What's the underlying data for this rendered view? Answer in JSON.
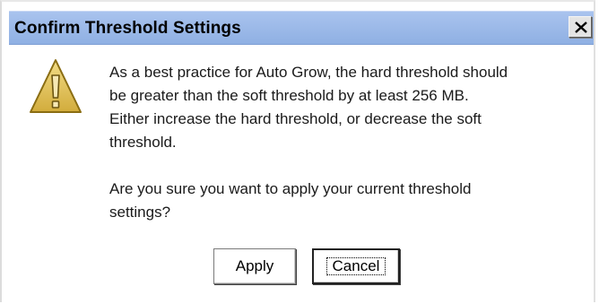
{
  "dialog": {
    "title": "Confirm Threshold Settings",
    "close_label": "X",
    "icon": "warning-icon",
    "message_lines": [
      "As a best practice for Auto Grow, the hard threshold should",
      "be greater than the soft threshold by at least 256 MB.",
      "Either increase the hard threshold, or decrease the soft",
      "threshold."
    ],
    "question_lines": [
      "Are you sure you want to apply your current threshold",
      "settings?"
    ],
    "buttons": {
      "apply": "Apply",
      "cancel": "Cancel"
    }
  },
  "colors": {
    "titlebar": "#9ab8e8",
    "icon_fill": "#e2c25a",
    "icon_outline": "#8a6d12"
  }
}
